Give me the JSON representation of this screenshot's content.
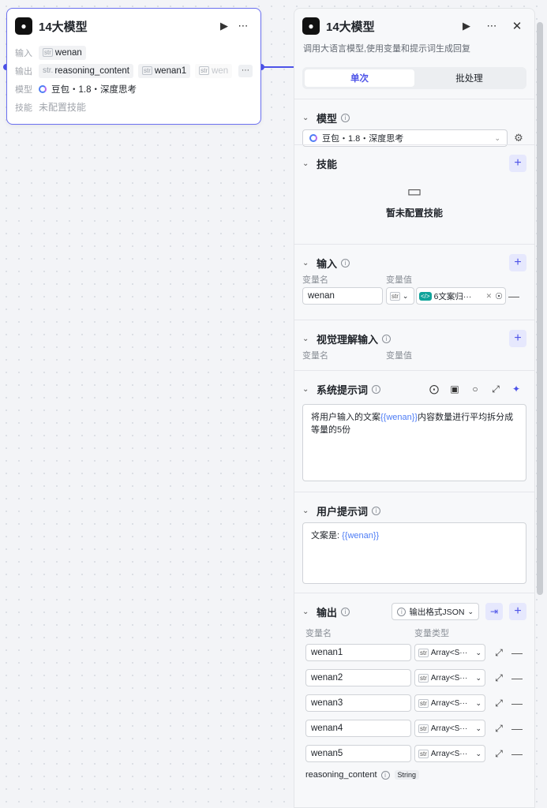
{
  "node": {
    "title": "14大模型",
    "input_label": "输入",
    "input_tag": "wenan",
    "output_label": "输出",
    "output_tags": [
      "reasoning_content",
      "wenan1",
      "wen"
    ],
    "output_type_prefix": "str.",
    "model_label": "模型",
    "model_value": "豆包・1.8・深度思考",
    "skill_label": "技能",
    "skill_value": "未配置技能"
  },
  "panel": {
    "title": "14大模型",
    "description": "调用大语言模型,使用变量和提示词生成回复",
    "tabs": [
      "单次",
      "批处理"
    ],
    "model_section": {
      "title": "模型",
      "value": "豆包・1.8・深度思考"
    },
    "skill_section": {
      "title": "技能",
      "empty_text": "暂未配置技能"
    },
    "input_section": {
      "title": "输入",
      "col_name": "变量名",
      "col_value": "变量值",
      "var_name": "wenan",
      "var_ref": "6文案归···"
    },
    "vision_section": {
      "title": "视觉理解输入",
      "col_name": "变量名",
      "col_value": "变量值"
    },
    "system_prompt": {
      "title": "系统提示词",
      "text_before": "将用户输入的文案",
      "var": "{{wenan}}",
      "text_after": "内容数量进行平均拆分成等量的5份"
    },
    "user_prompt": {
      "title": "用户提示词",
      "text_before": "文案是: ",
      "var": "{{wenan}}"
    },
    "output_section": {
      "title": "输出",
      "format_button": "输出格式JSON",
      "col_name": "变量名",
      "col_type": "变量类型",
      "type_value": "Array<S···",
      "rows": [
        "wenan1",
        "wenan2",
        "wenan3",
        "wenan4",
        "wenan5"
      ],
      "reasoning_name": "reasoning_content",
      "reasoning_type": "String"
    }
  }
}
